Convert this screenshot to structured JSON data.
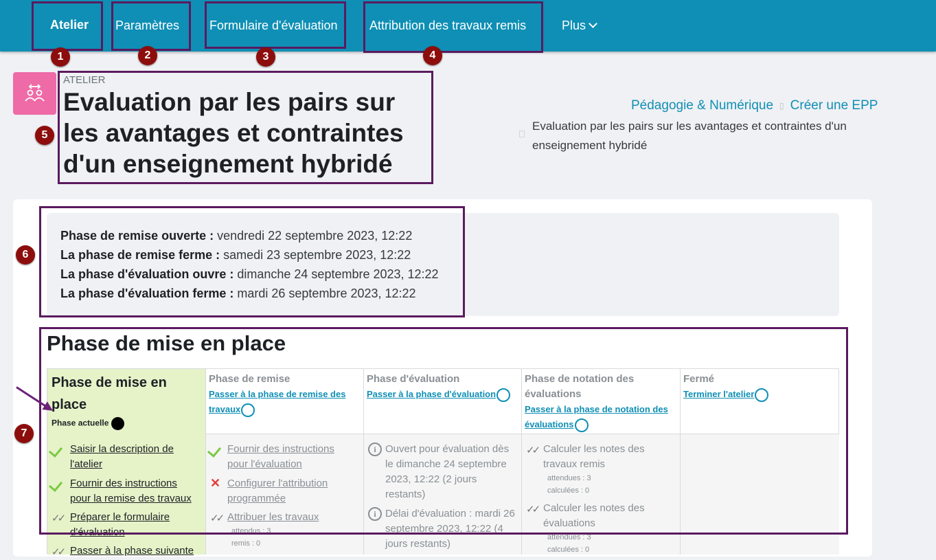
{
  "nav": {
    "items": [
      {
        "label": "Atelier",
        "active": true
      },
      {
        "label": "Paramètres"
      },
      {
        "label": "Formulaire d'évaluation"
      },
      {
        "label": "Attribution des travaux remis"
      },
      {
        "label": "Plus"
      }
    ]
  },
  "annotations": [
    "1",
    "2",
    "3",
    "4",
    "5",
    "6",
    "7"
  ],
  "header": {
    "activity_label": "ATELIER",
    "title": "Evaluation par les pairs sur les avantages et contraintes d'un enseignement hybridé",
    "activity_icon": "people-exchange-icon",
    "icon_color": "#ee6ba7"
  },
  "breadcrumb": {
    "items": [
      "Pédagogie & Numérique",
      "Créer une EPP"
    ],
    "current": "Evaluation par les pairs sur les avantages et contraintes d'un enseignement hybridé"
  },
  "dates": [
    {
      "label": "Phase de remise ouverte :",
      "value": "vendredi 22 septembre 2023, 12:22"
    },
    {
      "label": "La phase de remise ferme :",
      "value": "samedi 23 septembre 2023, 12:22"
    },
    {
      "label": "La phase d'évaluation ouvre :",
      "value": "dimanche 24 septembre 2023, 12:22"
    },
    {
      "label": "La phase d'évaluation ferme :",
      "value": "mardi 26 septembre 2023, 12:22"
    }
  ],
  "phase_heading": "Phase de mise en place",
  "phases": {
    "setup": {
      "title": "Phase de mise en place",
      "current_label": "Phase actuelle",
      "tasks": [
        {
          "label": "Saisir la description de l'atelier",
          "status": "done"
        },
        {
          "label": "Fournir des instructions pour la remise des travaux",
          "status": "done"
        },
        {
          "label": "Préparer le formulaire d'évaluation",
          "status": "todo"
        },
        {
          "label": "Passer à la phase suivante",
          "status": "todo"
        }
      ]
    },
    "submission": {
      "title": "Phase de remise",
      "link": "Passer à la phase de remise des travaux",
      "tasks": [
        {
          "label": "Fournir des instructions pour l'évaluation",
          "status": "done"
        },
        {
          "label": "Configurer l'attribution programmée",
          "status": "fail"
        },
        {
          "label": "Attribuer les travaux",
          "status": "todo",
          "details": [
            "attendus : 3",
            "remis : 0"
          ]
        }
      ]
    },
    "assessment": {
      "title": "Phase d'évaluation",
      "link": "Passer à la phase d'évaluation",
      "tasks": [
        {
          "label": "Ouvert pour évaluation dès le dimanche 24 septembre 2023, 12:22 (2 jours restants)",
          "status": "info"
        },
        {
          "label": "Délai d'évaluation : mardi 26 septembre 2023, 12:22 (4 jours restants)",
          "status": "info"
        }
      ]
    },
    "grading": {
      "title": "Phase de notation des évaluations",
      "link": "Passer à la phase de notation des évaluations",
      "tasks": [
        {
          "label": "Calculer les notes des travaux remis",
          "status": "todo",
          "details": [
            "attendues : 3",
            "calculées : 0"
          ]
        },
        {
          "label": "Calculer les notes des évaluations",
          "status": "todo",
          "details": [
            "attendues : 3",
            "calculées : 0"
          ]
        }
      ]
    },
    "closed": {
      "title": "Fermé",
      "link": "Terminer l'atelier"
    }
  },
  "colors": {
    "nav_bg": "#0f8fb5",
    "annotation": "#5a1a5f",
    "badge": "#8d0d0d",
    "current_phase_bg": "#e6f2c8",
    "link": "#0f8fb5"
  }
}
